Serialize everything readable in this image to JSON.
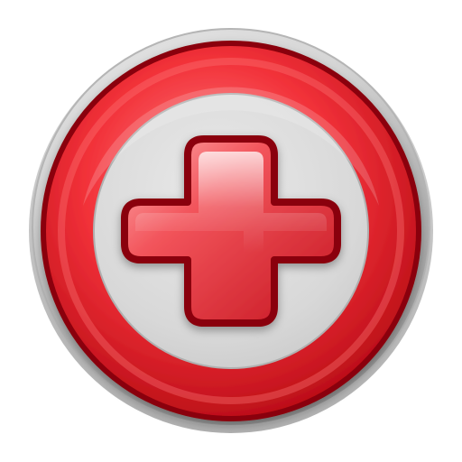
{
  "app": {
    "title": ""
  },
  "icon": {
    "name": "plus-icon",
    "shape": "circular button with red ring and red plus sign"
  },
  "colors": {
    "bezel_light": "#f2f2f2",
    "bezel_mid": "#cfcfcf",
    "bezel_dark": "#8f8f8f",
    "ring_red_light": "#ff6a6a",
    "ring_red": "#e3232b",
    "ring_red_dark": "#a5000a",
    "inner_face": "#d9d9d9",
    "plus_light": "#ffd0d0",
    "plus_red": "#ef3a43",
    "plus_dark": "#b9101a"
  }
}
